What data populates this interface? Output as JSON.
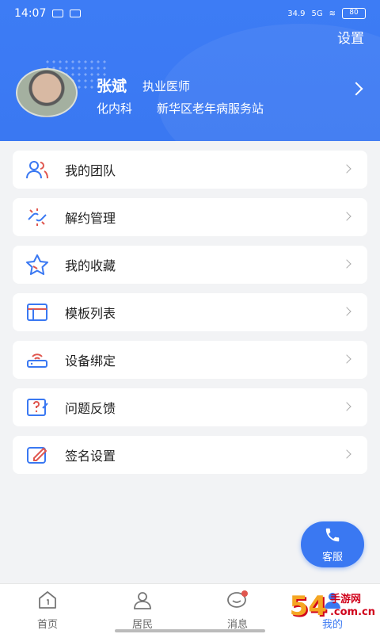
{
  "status_bar": {
    "time": "14:07",
    "signal_text": "5G",
    "network_speed": "34.9",
    "battery": "80"
  },
  "header": {
    "settings_label": "设置",
    "doctor_name": "张斌",
    "doctor_title": "执业医师",
    "department": "化内科",
    "station": "新华区老年病服务站"
  },
  "menu": {
    "items": [
      {
        "label": "我的团队",
        "icon": "team-icon"
      },
      {
        "label": "解约管理",
        "icon": "unlink-icon"
      },
      {
        "label": "我的收藏",
        "icon": "star-icon"
      },
      {
        "label": "模板列表",
        "icon": "template-icon"
      },
      {
        "label": "设备绑定",
        "icon": "device-icon"
      },
      {
        "label": "问题反馈",
        "icon": "feedback-icon"
      },
      {
        "label": "签名设置",
        "icon": "signature-icon"
      }
    ]
  },
  "fab": {
    "label": "客服",
    "icon": "phone-icon"
  },
  "tabbar": {
    "tabs": [
      {
        "label": "首页",
        "icon": "home-icon"
      },
      {
        "label": "居民",
        "icon": "resident-icon"
      },
      {
        "label": "消息",
        "icon": "message-icon"
      },
      {
        "label": "我的",
        "icon": "profile-icon"
      }
    ]
  },
  "watermark": {
    "number": "54",
    "line1": "手游网",
    "line2": ".com.cn"
  },
  "colors": {
    "brand": "#3a78f2",
    "background": "#f2f3f5"
  }
}
